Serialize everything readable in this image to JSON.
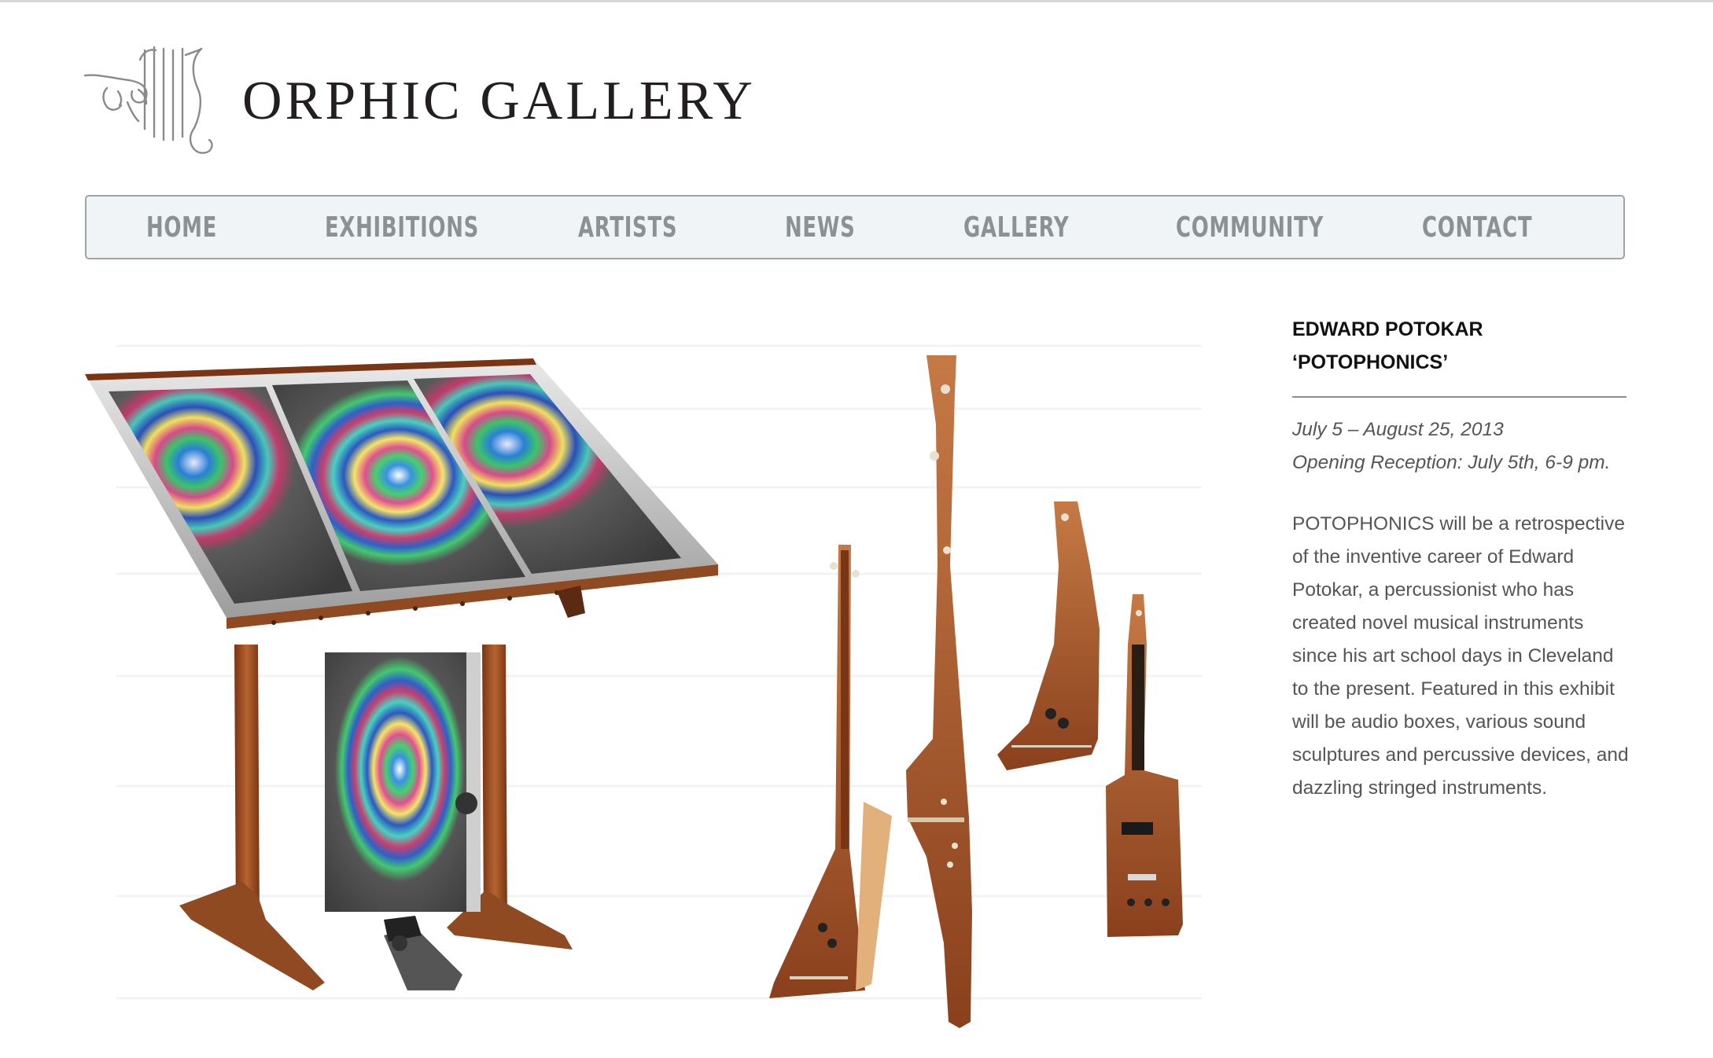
{
  "site": {
    "title": "ORPHIC GALLERY"
  },
  "nav": {
    "items": [
      "HOME",
      "EXHIBITIONS",
      "ARTISTS",
      "NEWS",
      "GALLERY",
      "COMMUNITY",
      "CONTACT"
    ]
  },
  "exhibition": {
    "title_lines": [
      "EDWARD POTOKAR",
      "‘POTOPHONICS’"
    ],
    "date_lines": [
      "July 5 – August 25, 2013",
      "Opening Reception:  July 5th, 6-9 pm."
    ],
    "description_lines": [
      "POTOPHONICS will be a retrospective",
      "of the inventive career of Edward",
      "Potokar, a percussionist who has",
      "created novel musical instruments",
      "since his art school days in Cleveland",
      "to the present. Featured in this exhibit",
      "will be audio boxes, various sound",
      "sculptures and percussive devices, and",
      "dazzling stringed instruments."
    ]
  },
  "icons": {
    "logo": "lyre-hand-logo-icon",
    "hero": "instrument-photo"
  },
  "colors": {
    "nav_background": "#f0f4f7",
    "nav_text": "#8c9194",
    "wood": "#a0522d"
  }
}
